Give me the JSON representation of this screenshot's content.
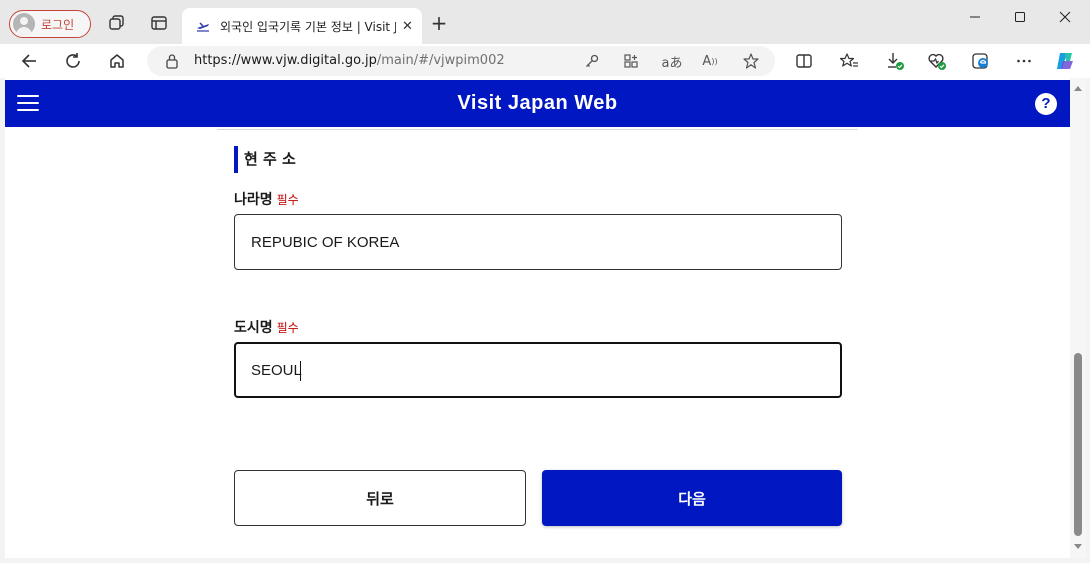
{
  "browser": {
    "profile_label": "로그인",
    "tab_title": "외국인 입국기록 기본 정보 | Visit Japan Web",
    "url_host": "https://www.vjw.digital.go.jp",
    "url_path": "/main/#/vjwpim002"
  },
  "site": {
    "title": "Visit Japan Web",
    "help_label": "?",
    "brand_color": "#0017c1"
  },
  "form": {
    "section_title": "현 주 소",
    "country": {
      "label": "나라명",
      "required": "필수",
      "value": "REPUBIC OF KOREA"
    },
    "city": {
      "label": "도시명",
      "required": "필수",
      "value": "SEOUL"
    }
  },
  "actions": {
    "back_label": "뒤로",
    "next_label": "다음"
  },
  "icons": [
    "profile-avatar-icon",
    "workspaces-icon",
    "tab-actions-icon",
    "site-favicon",
    "tab-close-icon",
    "new-tab-icon",
    "minimize-icon",
    "maximize-icon",
    "window-close-icon",
    "back-icon",
    "refresh-icon",
    "home-icon",
    "lock-icon",
    "key-icon",
    "app-install-icon",
    "translate-icon",
    "read-aloud-icon",
    "favorite-star-icon",
    "split-screen-icon",
    "favorites-icon",
    "downloads-icon",
    "browser-essentials-icon",
    "edge-collections-icon",
    "more-icon",
    "copilot-icon",
    "menu-icon",
    "help-icon"
  ]
}
